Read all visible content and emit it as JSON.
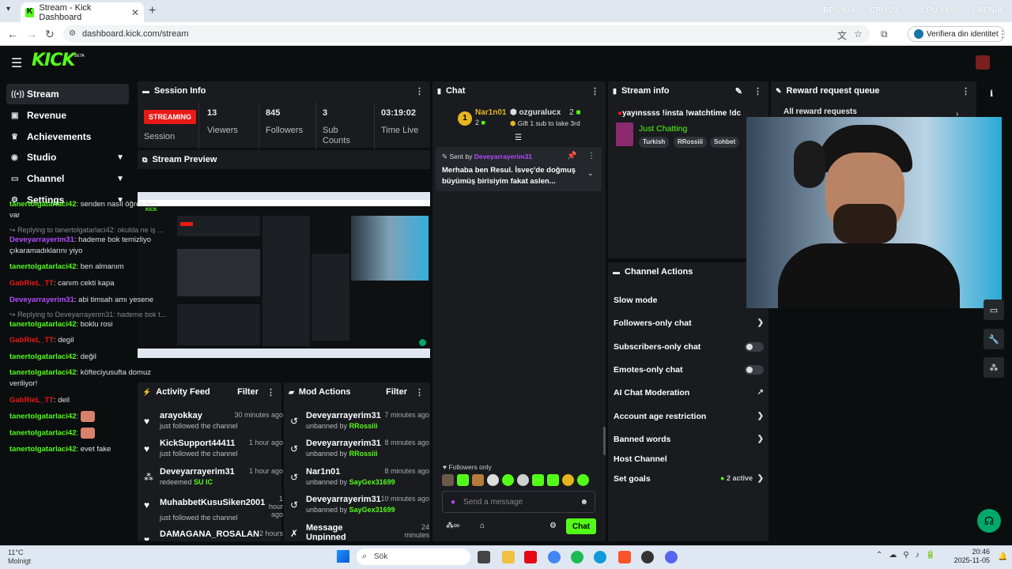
{
  "browser": {
    "tab_title": "Stream - Kick Dashboard",
    "url": "dashboard.kick.com/stream",
    "verify_label": "Verifiera din identitet",
    "stats": [
      "BPS N/A",
      "CPU 29 %",
      "CPU 14 %",
      "LAT N/A"
    ]
  },
  "logo": {
    "text": "KICK",
    "badge": "BETA"
  },
  "sidebar": {
    "items": [
      {
        "label": "Stream",
        "icon": "radio-icon"
      },
      {
        "label": "Revenue",
        "icon": "dollar-icon"
      },
      {
        "label": "Achievements",
        "icon": "trophy-icon"
      },
      {
        "label": "Studio",
        "icon": "studio-icon"
      },
      {
        "label": "Channel",
        "icon": "channel-icon"
      },
      {
        "label": "Settings",
        "icon": "gear-icon"
      }
    ]
  },
  "session": {
    "title": "Session Info",
    "status": "STREAMING",
    "status_label": "Session",
    "viewers": "13",
    "viewers_label": "Viewers",
    "followers": "845",
    "followers_label": "Followers",
    "subs": "3",
    "subs_label": "Sub Counts",
    "time": "03:19:02",
    "time_label": "Time Live"
  },
  "preview": {
    "title": "Stream Preview"
  },
  "activity": {
    "title": "Activity Feed",
    "filter": "Filter",
    "items": [
      {
        "name": "arayokkay",
        "time": "30 minutes ago",
        "sub": "just followed the channel"
      },
      {
        "name": "KickSupport44411",
        "time": "1 hour ago",
        "sub": "just followed the channel"
      },
      {
        "name": "Deveyarrayerim31",
        "time": "1 hour ago",
        "sub": "redeemed",
        "extra": "SU IC"
      },
      {
        "name": "MuhabbetKusuSiken2001",
        "time": "1 hour ago",
        "sub": "just followed the channel"
      },
      {
        "name": "DAMAGANA_ROSALAN",
        "time": "2 hours",
        "sub": ""
      }
    ]
  },
  "mod": {
    "title": "Mod Actions",
    "filter": "Filter",
    "items": [
      {
        "name": "Deveyarrayerim31",
        "time": "7 minutes ago",
        "sub": "unbanned by",
        "by": "RRossiii"
      },
      {
        "name": "Deveyarrayerim31",
        "time": "8 minutes ago",
        "sub": "unbanned by",
        "by": "RRossiii"
      },
      {
        "name": "Nar1n01",
        "time": "8 minutes ago",
        "sub": "unbanned by",
        "by": "SayGex31699"
      },
      {
        "name": "Deveyarrayerim31",
        "time": "10 minutes ago",
        "sub": "unbanned by",
        "by": "SayGex31699"
      },
      {
        "name": "Message Unpinned",
        "time": "24 minutes ago",
        "sub": "",
        "by": ""
      }
    ]
  },
  "chat": {
    "title": "Chat",
    "top1_name": "Nar1n01",
    "top1_count": "2",
    "top2_name": "ozguralucx",
    "top2_count": "2",
    "gift_text": "Gift 1 sub to take 3rd",
    "pinned_by_label": "Sent by",
    "pinned_by": "Deveyarrayerim31",
    "pinned_text": "Merhaba ben Resul. İsveç'de doğmuş büyümüş birisiyim fakat aslen...",
    "messages": [
      {
        "user": "tanertolgatarlaci42",
        "color": "g",
        "text": "senden nasıl öğretmen var"
      },
      {
        "reply": "Replying to tanertolgatarlaci42: okulda ne iş ..."
      },
      {
        "user": "Deveyarrayerim31",
        "color": "p",
        "text": "hademe bok temizliyo çıkaramadıklarını yiyo"
      },
      {
        "user": "tanertolgatarlaci42",
        "color": "g",
        "text": "ben almanım"
      },
      {
        "user": "GabRieL_TT",
        "color": "r",
        "text": "canım cekti kapa"
      },
      {
        "user": "Deveyarrayerim31",
        "color": "p",
        "text": "abi timsah amı yesene"
      },
      {
        "reply": "Replying to Deveyarrayerim31: hademe bok t..."
      },
      {
        "user": "tanertolgatarlaci42",
        "color": "g",
        "text": "boklu rosi"
      },
      {
        "user": "GabRieL_TT",
        "color": "r",
        "text": "degil"
      },
      {
        "user": "tanertolgatarlaci42",
        "color": "g",
        "text": "değil"
      },
      {
        "user": "tanertolgatarlaci42",
        "color": "g",
        "text": "köfteciyusufta domuz veriliyor!"
      },
      {
        "user": "GabRieL_TT",
        "color": "r",
        "text": "deil"
      },
      {
        "user": "tanertolgatarlaci42",
        "color": "g",
        "text": ""
      },
      {
        "user": "tanertolgatarlaci42",
        "color": "g",
        "text": ""
      },
      {
        "user": "tanertolgatarlaci42",
        "color": "g",
        "text": "evet fake"
      }
    ],
    "followers_only": "Followers only",
    "input_placeholder": "Send a message",
    "send_label": "Chat"
  },
  "stream_info": {
    "title": "Stream info",
    "stream_title": "yayınssss !insta !watchtime !dc",
    "category": "Just Chatting",
    "tags": [
      "Turkish",
      "RRossiii",
      "Sohbet"
    ]
  },
  "reward": {
    "title": "Reward request queue",
    "all_label": "All reward requests"
  },
  "channel_actions": {
    "title": "Channel Actions",
    "rows": [
      {
        "label": "Slow mode"
      },
      {
        "label": "Followers-only chat"
      },
      {
        "label": "Subscribers-only chat"
      },
      {
        "label": "Emotes-only chat"
      },
      {
        "label": "AI Chat Moderation"
      },
      {
        "label": "Account age restriction"
      },
      {
        "label": "Banned words"
      },
      {
        "label": "Host Channel"
      },
      {
        "label": "Set goals",
        "extra": "2 active"
      }
    ]
  },
  "taskbar": {
    "temp": "11°C",
    "weather": "Molnigt",
    "search": "Sök",
    "time": "20:46",
    "date": "2025-11-05"
  }
}
